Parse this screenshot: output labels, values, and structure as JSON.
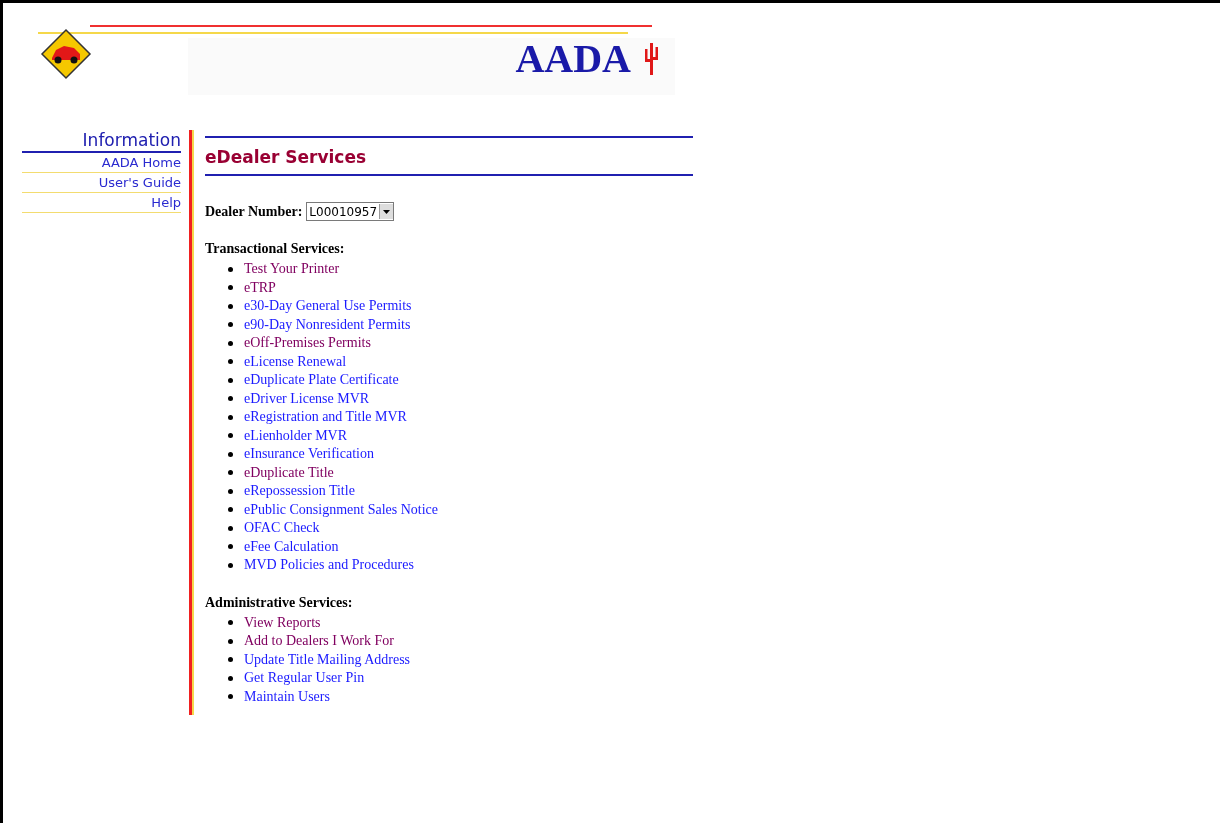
{
  "header": {
    "logo_text": "AADA"
  },
  "sidebar": {
    "title": "Information",
    "items": [
      {
        "label": "AADA Home"
      },
      {
        "label": "User's Guide"
      },
      {
        "label": "Help"
      }
    ]
  },
  "main": {
    "title": "eDealer Services",
    "dealer_label": "Dealer Number:",
    "dealer_value": "L00010957",
    "sections": [
      {
        "heading": "Transactional Services:",
        "links": [
          {
            "label": "Test Your Printer",
            "visited": true
          },
          {
            "label": "eTRP",
            "visited": true
          },
          {
            "label": "e30-Day General Use Permits",
            "visited": false
          },
          {
            "label": "e90-Day Nonresident Permits",
            "visited": false
          },
          {
            "label": "eOff-Premises Permits",
            "visited": true
          },
          {
            "label": "eLicense Renewal",
            "visited": false
          },
          {
            "label": "eDuplicate Plate Certificate",
            "visited": false
          },
          {
            "label": "eDriver License MVR",
            "visited": false
          },
          {
            "label": "eRegistration and Title MVR",
            "visited": false
          },
          {
            "label": "eLienholder MVR",
            "visited": false
          },
          {
            "label": "eInsurance Verification",
            "visited": false
          },
          {
            "label": "eDuplicate Title",
            "visited": true
          },
          {
            "label": "eRepossession Title",
            "visited": false
          },
          {
            "label": "ePublic Consignment Sales Notice",
            "visited": false
          },
          {
            "label": "OFAC Check",
            "visited": false
          },
          {
            "label": "eFee Calculation",
            "visited": false
          },
          {
            "label": "MVD Policies and Procedures",
            "visited": false
          }
        ]
      },
      {
        "heading": "Administrative Services:",
        "links": [
          {
            "label": "View Reports",
            "visited": true
          },
          {
            "label": "Add to Dealers I Work For",
            "visited": true
          },
          {
            "label": "Update Title Mailing Address",
            "visited": false
          },
          {
            "label": "Get Regular User Pin",
            "visited": false
          },
          {
            "label": "Maintain Users",
            "visited": false
          }
        ]
      }
    ]
  }
}
